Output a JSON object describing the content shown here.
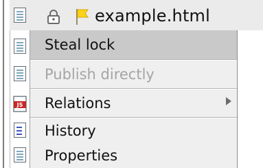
{
  "header": {
    "filename": "example.html"
  },
  "icons": {
    "file_icon": "document-icon",
    "lock_icon": "lock-icon",
    "flag_icon": "yellow-flag-icon",
    "js_icon": "javascript-file-icon",
    "js_icon_text": "JS"
  },
  "context_menu": {
    "items": [
      {
        "label": "Steal lock",
        "state": "highlighted"
      },
      {
        "label": "Publish directly",
        "state": "disabled"
      },
      {
        "label": "Relations",
        "state": "normal",
        "has_submenu": true
      },
      {
        "label": "History",
        "state": "normal"
      },
      {
        "label": "Properties",
        "state": "normal"
      }
    ]
  },
  "colors": {
    "menu_background": "#efefef",
    "highlight": "#c9c9c9",
    "disabled_text": "#a5a5a5",
    "js_badge": "#c62828"
  }
}
